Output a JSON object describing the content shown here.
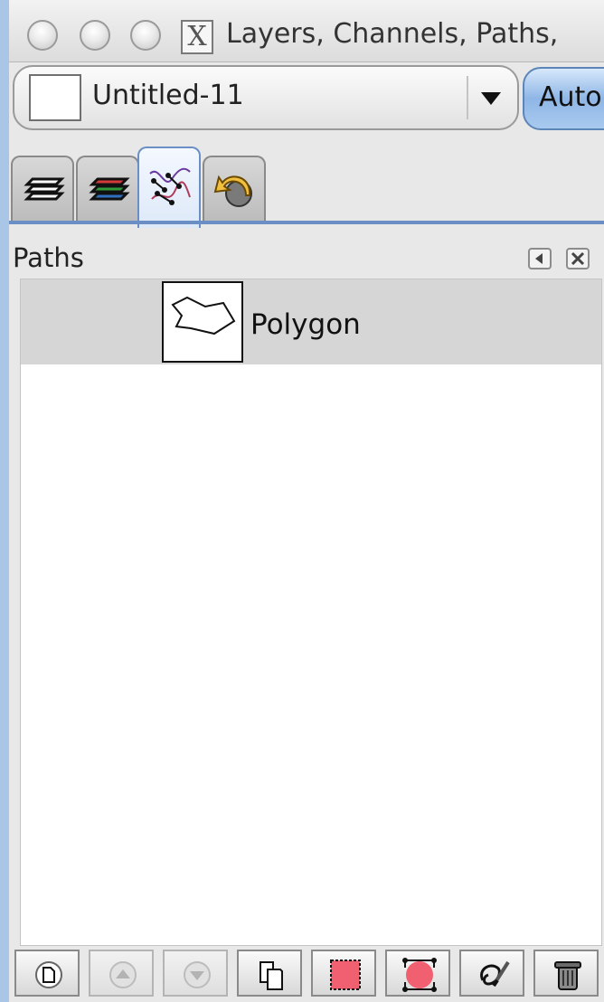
{
  "window": {
    "title": "Layers, Channels, Paths,",
    "title_icon": "x11-icon"
  },
  "image_select": {
    "value": "Untitled-11",
    "thumbnail": "blank-image-thumbnail"
  },
  "auto_button": {
    "label": "Auto"
  },
  "tabs": [
    {
      "icon": "layers-icon",
      "active": false
    },
    {
      "icon": "channels-icon",
      "active": false
    },
    {
      "icon": "paths-icon",
      "active": true
    },
    {
      "icon": "undo-history-icon",
      "active": false
    }
  ],
  "panel": {
    "title": "Paths"
  },
  "paths": [
    {
      "name": "Polygon",
      "thumbnail": "polygon-outline-thumbnail"
    }
  ],
  "buttons": [
    {
      "icon": "new-path-icon",
      "enabled": true
    },
    {
      "icon": "raise-path-icon",
      "enabled": false
    },
    {
      "icon": "lower-path-icon",
      "enabled": false
    },
    {
      "icon": "duplicate-path-icon",
      "enabled": true
    },
    {
      "icon": "path-to-selection-icon",
      "enabled": true
    },
    {
      "icon": "selection-to-path-icon",
      "enabled": true
    },
    {
      "icon": "stroke-path-icon",
      "enabled": true
    },
    {
      "icon": "delete-path-icon",
      "enabled": true
    }
  ],
  "colors": {
    "selection_accent": "#6b8fc4",
    "selected_row": "#d6d6d6",
    "path_fill_red": "#f06070"
  }
}
